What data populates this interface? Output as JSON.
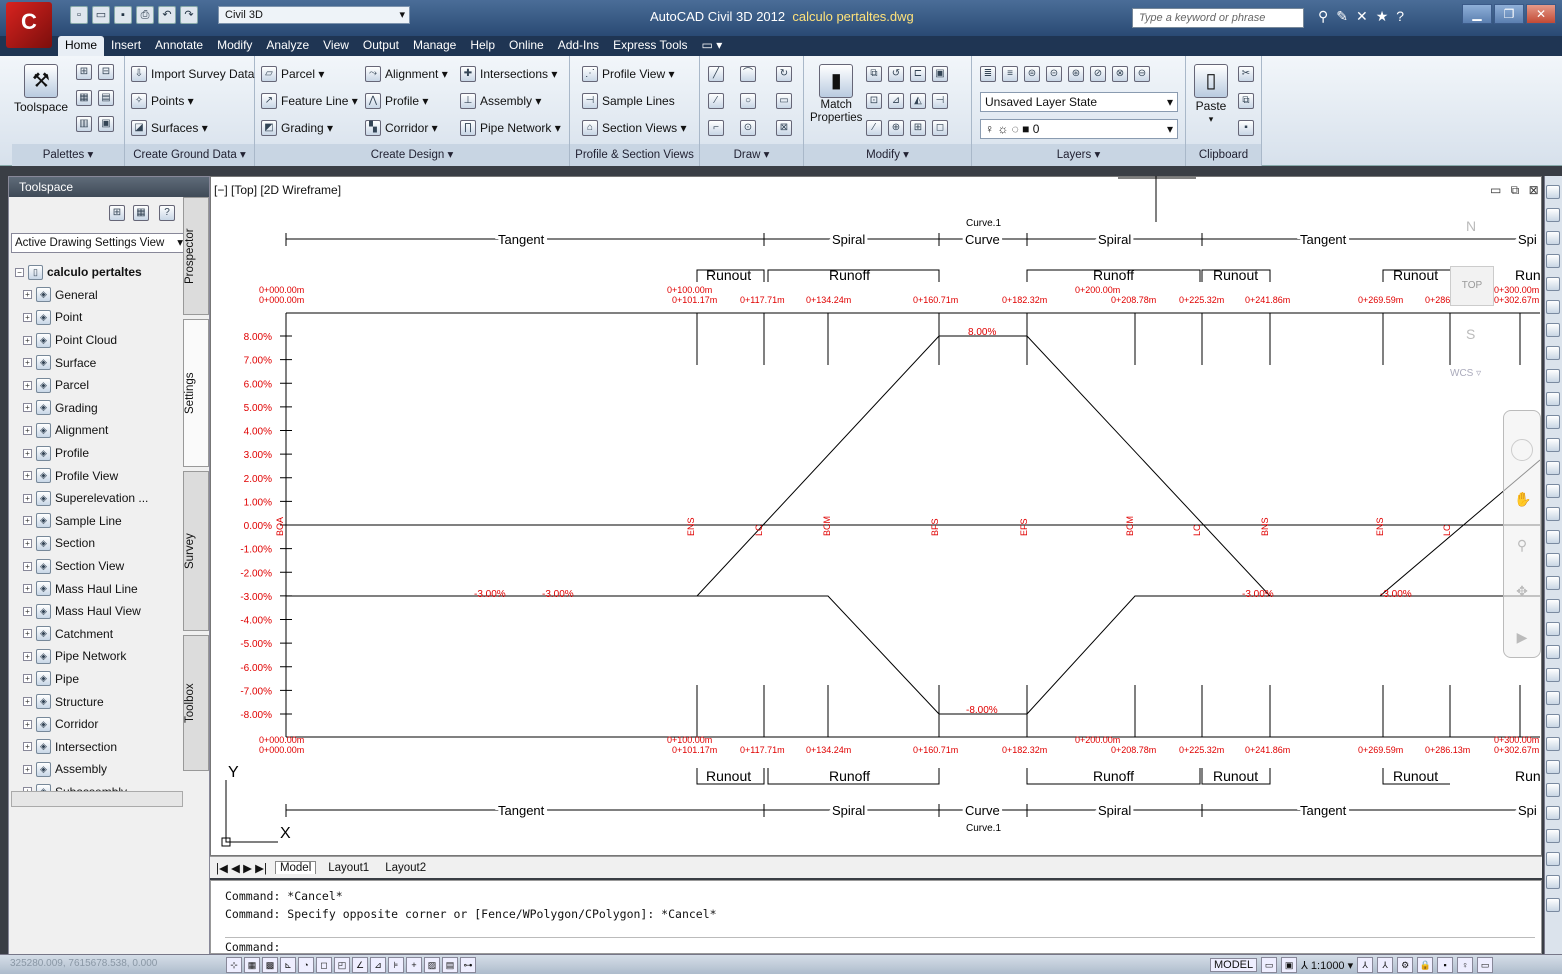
{
  "window": {
    "workspace": "Civil 3D",
    "app_title": "AutoCAD Civil 3D 2012",
    "file_name": "calculo pertaltes.dwg",
    "search_placeholder": "Type a keyword or phrase"
  },
  "tabs": [
    "Home",
    "Insert",
    "Annotate",
    "Modify",
    "Analyze",
    "View",
    "Output",
    "Manage",
    "Help",
    "Online",
    "Add-Ins",
    "Express Tools"
  ],
  "ribbon": {
    "palettes": {
      "title": "Palettes ▾",
      "toolspace": "Toolspace"
    },
    "ground": {
      "title": "Create Ground Data ▾",
      "import": "Import Survey Data",
      "points": "Points ▾",
      "surfaces": "Surfaces ▾"
    },
    "design": {
      "title": "Create Design ▾",
      "parcel": "Parcel ▾",
      "feature_line": "Feature Line ▾",
      "grading": "Grading ▾",
      "alignment": "Alignment ▾",
      "profile": "Profile ▾",
      "corridor": "Corridor ▾",
      "intersections": "Intersections ▾",
      "assembly": "Assembly ▾",
      "pipe_network": "Pipe Network ▾"
    },
    "views": {
      "title": "Profile & Section Views",
      "profile_view": "Profile View ▾",
      "sample_lines": "Sample Lines",
      "section_views": "Section Views ▾"
    },
    "draw": {
      "title": "Draw ▾"
    },
    "modify": {
      "title": "Modify ▾",
      "match": "Match",
      "properties": "Properties"
    },
    "layers": {
      "title": "Layers ▾",
      "layer_state": "Unsaved Layer State",
      "current_layer": "0"
    },
    "clipboard": {
      "title": "Clipboard",
      "paste": "Paste"
    }
  },
  "toolspace": {
    "title": "Toolspace",
    "view_select": "Active Drawing Settings View",
    "root": "calculo pertaltes",
    "items": [
      "General",
      "Point",
      "Point Cloud",
      "Surface",
      "Parcel",
      "Grading",
      "Alignment",
      "Profile",
      "Profile View",
      "Superelevation ...",
      "Sample Line",
      "Section",
      "Section View",
      "Mass Haul Line",
      "Mass Haul View",
      "Catchment",
      "Pipe Network",
      "Pipe",
      "Structure",
      "Corridor",
      "Intersection",
      "Assembly",
      "Subassembly"
    ],
    "tabs": [
      "Prospector",
      "Settings",
      "Survey",
      "Toolbox"
    ]
  },
  "viewport": {
    "label": "[−] [Top] [2D Wireframe]"
  },
  "viewcube": {
    "north": "N",
    "south": "S",
    "top": "TOP",
    "wcs": "WCS ▿"
  },
  "diagram": {
    "top_segments": [
      "Tangent",
      "Spiral",
      "Curve",
      "Spiral",
      "Tangent",
      "Spi"
    ],
    "curve_label": "Curve.1",
    "regions": [
      "Runout",
      "Runoff",
      "Runoff",
      "Runout",
      "Runout",
      "Run"
    ],
    "stations_top": [
      "0+000.00m",
      "0+000.00m",
      "0+100.00m",
      "0+101.17m",
      "0+117.71m",
      "0+134.24m",
      "0+160.71m",
      "0+182.32m",
      "0+200.00m",
      "0+208.78m",
      "0+225.32m",
      "0+241.86m",
      "0+269.59m",
      "0+286.13m",
      "0+300.00m",
      "0+302.67m"
    ],
    "y_ticks": [
      "8.00%",
      "7.00%",
      "6.00%",
      "5.00%",
      "4.00%",
      "3.00%",
      "2.00%",
      "1.00%",
      "0.00%",
      "-1.00%",
      "-2.00%",
      "-3.00%",
      "-4.00%",
      "-5.00%",
      "-6.00%",
      "-7.00%",
      "-8.00%"
    ],
    "slope_labels": [
      "8.00%",
      "-3.00%",
      "-3.00%",
      "-8.00%",
      "-3.00%",
      "-3.00%"
    ],
    "markers": [
      "BOA",
      "ENS",
      "LC",
      "BCM",
      "BFS",
      "EFS",
      "BCM",
      "LC",
      "BNS",
      "ENS",
      "LC"
    ]
  },
  "layout_tabs": [
    "Model",
    "Layout1",
    "Layout2"
  ],
  "command": {
    "line1": "Command: *Cancel*",
    "line2": "Command: Specify opposite corner or [Fence/WPolygon/CPolygon]: *Cancel*",
    "prompt": "Command:"
  },
  "status": {
    "coords": "325280.009, 7615678.538, 0.000",
    "model": "MODEL",
    "scale": "1:1000 ▾"
  }
}
